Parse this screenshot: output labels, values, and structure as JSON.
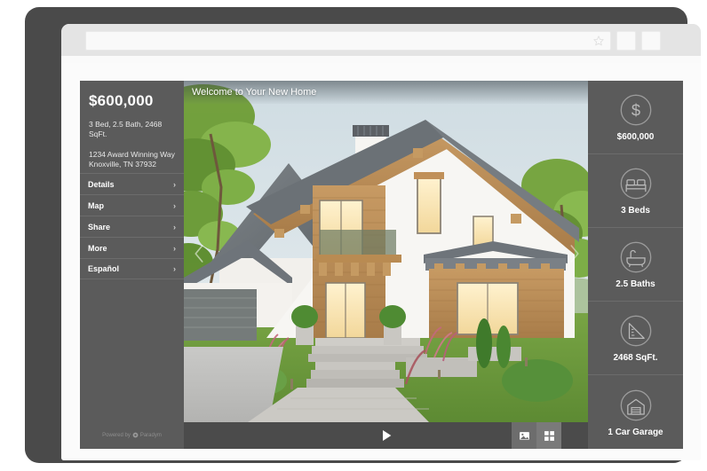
{
  "browser": {
    "address_value": "",
    "address_placeholder": "",
    "bookmark_icon": "star-icon",
    "button_1_icon": "blank-button",
    "button_2_icon": "blank-button"
  },
  "listing": {
    "price": "$600,000",
    "specs": "3 Bed, 2.5 Bath, 2468 SqFt.",
    "address_line1": "1234 Award Winning Way",
    "address_line2": "Knoxville, TN 37932",
    "menu": [
      {
        "label": "Details",
        "chevron": "›",
        "icon": "chevron-right-icon"
      },
      {
        "label": "Map",
        "chevron": "›",
        "icon": "chevron-right-icon"
      },
      {
        "label": "Share",
        "chevron": "›",
        "icon": "chevron-right-icon"
      },
      {
        "label": "More",
        "chevron": "›",
        "icon": "chevron-right-icon"
      },
      {
        "label": "Español",
        "chevron": "›",
        "icon": "chevron-right-icon"
      }
    ],
    "powered_by": "Powered by",
    "powered_brand": "Paradym"
  },
  "viewer": {
    "banner_text": "Welcome to Your New Home",
    "prev_icon": "chevron-left-icon",
    "next_icon": "chevron-right-icon",
    "play_icon": "play-icon",
    "photo_tool_icon": "photo-icon",
    "grid_tool_icon": "grid-icon",
    "photo_alt": "exterior-front-elevation-modern-chalet-house"
  },
  "features": [
    {
      "icon": "dollar-icon",
      "label": "$600,000"
    },
    {
      "icon": "bed-icon",
      "label": "3 Beds"
    },
    {
      "icon": "bathtub-icon",
      "label": "2.5 Baths"
    },
    {
      "icon": "ruler-icon",
      "label": "2468 SqFt."
    },
    {
      "icon": "garage-icon",
      "label": "1 Car Garage"
    }
  ],
  "colors": {
    "panel": "#5b5b5b",
    "bezel": "#4a4a4a",
    "toolbar": "#4b4b4b",
    "divider": "#6c6c6c",
    "page": "#fbfbfb",
    "chrome": "#e4e4e4"
  }
}
